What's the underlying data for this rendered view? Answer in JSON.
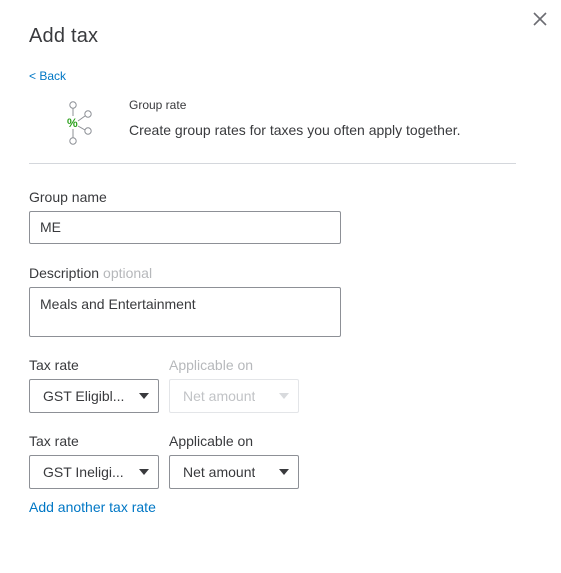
{
  "dialog": {
    "title": "Add tax",
    "back_label": "< Back",
    "close_icon": "close-icon"
  },
  "group_rate": {
    "icon": "group-rate-icon",
    "icon_symbol": "%",
    "heading": "Group rate",
    "description": "Create group rates for taxes you often apply together."
  },
  "form": {
    "group_name": {
      "label": "Group name",
      "value": "ME"
    },
    "description": {
      "label": "Description",
      "optional_label": "optional",
      "value": "Meals and Entertainment"
    },
    "tax_rates": [
      {
        "tax_rate_label": "Tax rate",
        "tax_rate_value": "GST Eligibl...",
        "applicable_label": "Applicable on",
        "applicable_value": "Net amount",
        "applicable_disabled": true
      },
      {
        "tax_rate_label": "Tax rate",
        "tax_rate_value": "GST Ineligi...",
        "applicable_label": "Applicable on",
        "applicable_value": "Net amount",
        "applicable_disabled": false
      }
    ],
    "add_rate_label": "Add another tax rate"
  },
  "colors": {
    "link": "#0077c5",
    "text": "#393a3d",
    "disabled_text": "#b6b8bb",
    "icon_green": "#2ca01c",
    "border": "#8d9096"
  }
}
